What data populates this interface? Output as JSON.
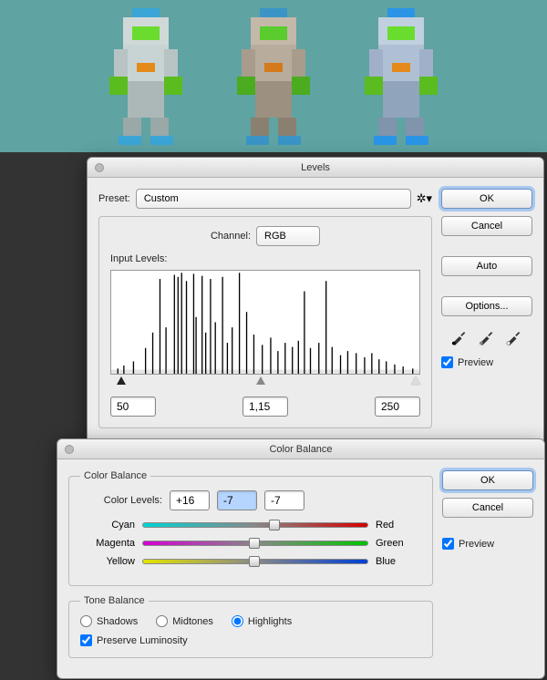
{
  "levels": {
    "title": "Levels",
    "preset_label": "Preset:",
    "preset_value": "Custom",
    "channel_label": "Channel:",
    "channel_value": "RGB",
    "input_levels_label": "Input Levels:",
    "black": "50",
    "gamma": "1,15",
    "white": "250",
    "ok": "OK",
    "cancel": "Cancel",
    "auto": "Auto",
    "options": "Options...",
    "preview": "Preview"
  },
  "cb": {
    "title": "Color Balance",
    "group_cb": "Color Balance",
    "levels_label": "Color Levels:",
    "v1": "+16",
    "v2": "-7",
    "v3": "-7",
    "cyan": "Cyan",
    "red": "Red",
    "magenta": "Magenta",
    "green": "Green",
    "yellow": "Yellow",
    "blue": "Blue",
    "group_tone": "Tone Balance",
    "shadows": "Shadows",
    "midtones": "Midtones",
    "highlights": "Highlights",
    "preserve": "Preserve Luminosity",
    "ok": "OK",
    "cancel": "Cancel",
    "preview": "Preview"
  }
}
